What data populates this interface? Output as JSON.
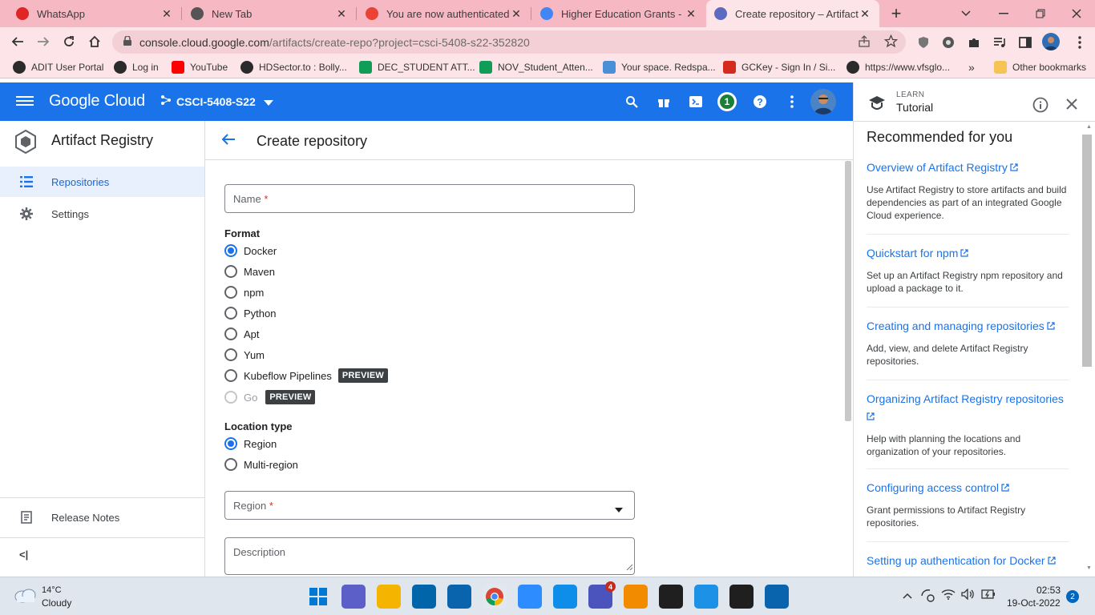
{
  "browser": {
    "tabs": [
      {
        "title": "WhatsApp",
        "icon": "whatsapp-icon",
        "color": "#e02525"
      },
      {
        "title": "New Tab",
        "icon": "chrome-icon",
        "color": "#555555"
      },
      {
        "title": "You are now authenticated w",
        "icon": "google-cloud-icon",
        "color": "#ea4335"
      },
      {
        "title": "Higher Education Grants - G",
        "icon": "google-icon",
        "color": "#4285f4"
      },
      {
        "title": "Create repository – Artifact R",
        "icon": "artifact-registry-icon",
        "color": "#5c6bc0"
      }
    ],
    "new_tab_symbol": "+",
    "url_host": "console.cloud.google.com",
    "url_path": "/artifacts/create-repo?project=csci-5408-s22-352820",
    "bookmarks": [
      {
        "label": "ADIT User Portal",
        "color": "#2b2b2b"
      },
      {
        "label": "Log in",
        "color": "#2b2b2b"
      },
      {
        "label": "YouTube",
        "color": "#ff0000"
      },
      {
        "label": "HDSector.to : Bolly...",
        "color": "#2b2b2b"
      },
      {
        "label": "DEC_STUDENT ATT...",
        "color": "#0f9d58"
      },
      {
        "label": "NOV_Student_Atten...",
        "color": "#0f9d58"
      },
      {
        "label": "Your space. Redspa...",
        "color": "#4a90d9"
      },
      {
        "label": "GCKey - Sign In / Si...",
        "color": "#d52b1e"
      },
      {
        "label": "https://www.vfsglo...",
        "color": "#2b2b2b"
      }
    ],
    "more_bookmarks": "»",
    "other_bookmarks": "Other bookmarks"
  },
  "header": {
    "logo": "Google Cloud",
    "project": "CSCI-5408-S22",
    "notification_count": "1"
  },
  "nav": {
    "product": "Artifact Registry",
    "items": [
      {
        "label": "Repositories",
        "icon": "list-icon",
        "selected": true
      },
      {
        "label": "Settings",
        "icon": "gear-icon",
        "selected": false
      }
    ],
    "release_notes": "Release Notes",
    "collapse": "<|"
  },
  "form": {
    "title": "Create repository",
    "name_placeholder": "Name",
    "required_mark": "*",
    "format_label": "Format",
    "formats": [
      {
        "label": "Docker",
        "selected": true,
        "disabled": false,
        "badge": ""
      },
      {
        "label": "Maven",
        "selected": false,
        "disabled": false,
        "badge": ""
      },
      {
        "label": "npm",
        "selected": false,
        "disabled": false,
        "badge": ""
      },
      {
        "label": "Python",
        "selected": false,
        "disabled": false,
        "badge": ""
      },
      {
        "label": "Apt",
        "selected": false,
        "disabled": false,
        "badge": ""
      },
      {
        "label": "Yum",
        "selected": false,
        "disabled": false,
        "badge": ""
      },
      {
        "label": "Kubeflow Pipelines",
        "selected": false,
        "disabled": false,
        "badge": "PREVIEW"
      },
      {
        "label": "Go",
        "selected": false,
        "disabled": true,
        "badge": "PREVIEW"
      }
    ],
    "location_label": "Location type",
    "locations": [
      {
        "label": "Region",
        "selected": true
      },
      {
        "label": "Multi-region",
        "selected": false
      }
    ],
    "region_placeholder": "Region",
    "description_placeholder": "Description"
  },
  "tutorial": {
    "eyebrow": "LEARN",
    "title": "Tutorial",
    "heading": "Recommended for you",
    "cards": [
      {
        "link": "Overview of Artifact Registry",
        "desc": "Use Artifact Registry to store artifacts and build dependencies as part of an integrated Google Cloud experience."
      },
      {
        "link": "Quickstart for npm",
        "desc": "Set up an Artifact Registry npm repository and upload a package to it."
      },
      {
        "link": "Creating and managing repositories",
        "desc": "Add, view, and delete Artifact Registry repositories."
      },
      {
        "link": "Organizing Artifact Registry repositories",
        "desc": "Help with planning the locations and organization of your repositories."
      },
      {
        "link": "Configuring access control",
        "desc": "Grant permissions to Artifact Registry repositories."
      },
      {
        "link": "Setting up authentication for Docker",
        "desc": ""
      }
    ]
  },
  "taskbar": {
    "temp": "14°C",
    "weather": "Cloudy",
    "time": "02:53",
    "date": "19-Oct-2022",
    "notif_count": "2",
    "teams_badge": "4",
    "apps": [
      {
        "name": "start-button",
        "color": "#0078d4"
      },
      {
        "name": "chat-app",
        "color": "#5b5fc7"
      },
      {
        "name": "file-explorer",
        "color": "#f4b400"
      },
      {
        "name": "vscode",
        "color": "#0065a9"
      },
      {
        "name": "outlook",
        "color": "#0a64ad"
      },
      {
        "name": "chrome",
        "color": "#34a853"
      },
      {
        "name": "zoom",
        "color": "#2d8cff"
      },
      {
        "name": "teamviewer",
        "color": "#0e8ee9"
      },
      {
        "name": "teams",
        "color": "#4b53bc"
      },
      {
        "name": "sublime-text",
        "color": "#f28b00"
      },
      {
        "name": "terminal",
        "color": "#1f1f1f"
      },
      {
        "name": "docker",
        "color": "#1d91e6"
      },
      {
        "name": "terminal-2",
        "color": "#1f1f1f"
      },
      {
        "name": "outlook-2",
        "color": "#0a64ad"
      }
    ]
  }
}
